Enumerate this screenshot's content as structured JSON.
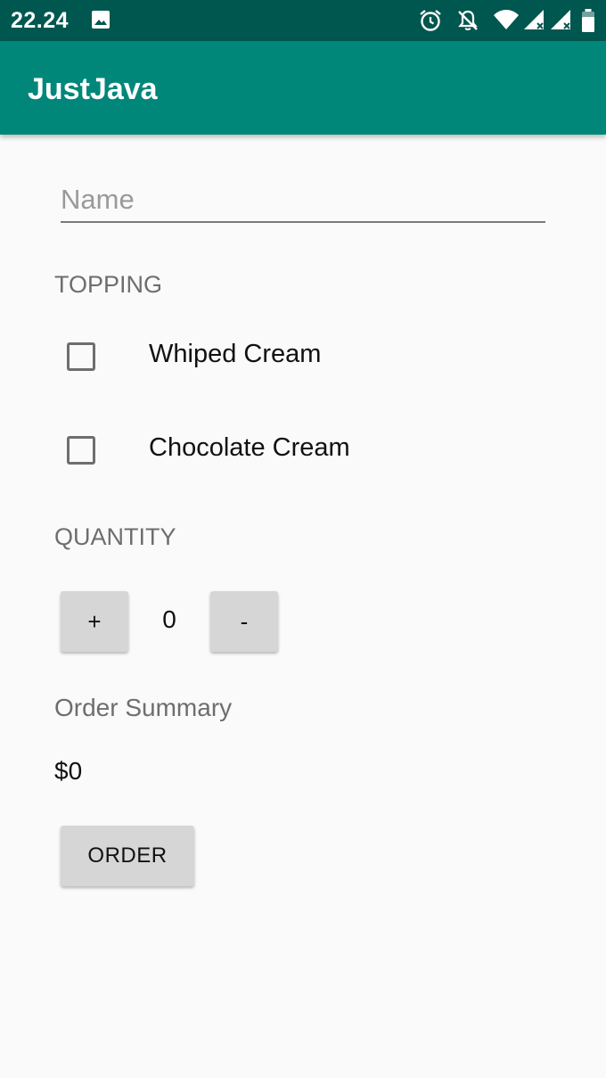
{
  "status_bar": {
    "time": "22.24",
    "icons": [
      "image-icon",
      "alarm-icon",
      "notifications-off-icon",
      "wifi-icon",
      "signal-icon",
      "signal-icon-2",
      "battery-icon"
    ]
  },
  "app_bar": {
    "title": "JustJava"
  },
  "name_field": {
    "placeholder": "Name",
    "value": ""
  },
  "topping": {
    "header": "TOPPING",
    "options": [
      {
        "label": "Whiped Cream",
        "checked": false
      },
      {
        "label": "Chocolate Cream",
        "checked": false
      }
    ]
  },
  "quantity": {
    "header": "QUANTITY",
    "increment_label": "+",
    "value": "0",
    "decrement_label": "-"
  },
  "summary": {
    "title": "Order Summary",
    "price": "$0"
  },
  "order_button": {
    "label": "ORDER"
  },
  "colors": {
    "status_bar": "#00574f",
    "app_bar": "#00877a",
    "background": "#fafafa",
    "button": "#d6d6d6"
  }
}
